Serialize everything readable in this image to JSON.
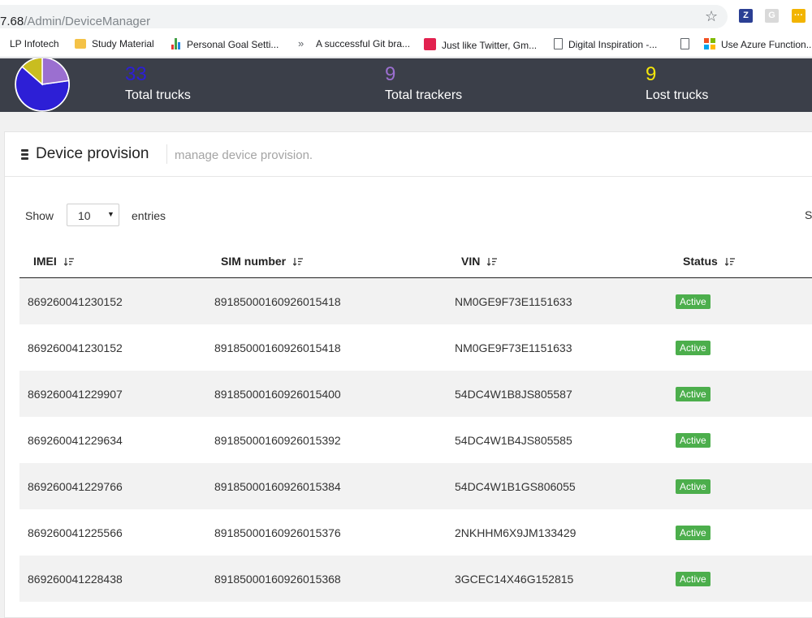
{
  "browser": {
    "url_host": "7.68",
    "url_path": "/Admin/DeviceManager",
    "bookmarks": [
      "LP Infotech",
      "Study Material",
      "Personal Goal Setti...",
      "A successful Git bra...",
      "Just like Twitter, Gm...",
      "Digital Inspiration -...",
      "Use Azure Function..."
    ],
    "extensions": [
      "Z",
      "G",
      ""
    ]
  },
  "stats": {
    "pie_colors": [
      "#2d1fd6",
      "#9b6fd0",
      "#c9bd20"
    ],
    "items": [
      {
        "value": "33",
        "label": "Total trucks",
        "color": "#2d1fd6"
      },
      {
        "value": "9",
        "label": "Total trackers",
        "color": "#9b6fd0"
      },
      {
        "value": "9",
        "label": "Lost trucks",
        "color": "#f5e60b"
      }
    ]
  },
  "panel": {
    "title": "Device provision",
    "subtitle": "manage device provision."
  },
  "controls": {
    "show_label": "Show",
    "page_size": "10",
    "entries_label": "entries",
    "search_label_cut": "S"
  },
  "table": {
    "headers": [
      "IMEI",
      "SIM number",
      "VIN",
      "Status"
    ],
    "rows": [
      {
        "imei": "869260041230152",
        "sim": "89185000160926015418",
        "vin": "NM0GE9F73E1151633",
        "status": "Active"
      },
      {
        "imei": "869260041230152",
        "sim": "89185000160926015418",
        "vin": "NM0GE9F73E1151633",
        "status": "Active"
      },
      {
        "imei": "869260041229907",
        "sim": "89185000160926015400",
        "vin": "54DC4W1B8JS805587",
        "status": "Active"
      },
      {
        "imei": "869260041229634",
        "sim": "89185000160926015392",
        "vin": "54DC4W1B4JS805585",
        "status": "Active"
      },
      {
        "imei": "869260041229766",
        "sim": "89185000160926015384",
        "vin": "54DC4W1B1GS806055",
        "status": "Active"
      },
      {
        "imei": "869260041225566",
        "sim": "89185000160926015376",
        "vin": "2NKHHM6X9JM133429",
        "status": "Active"
      },
      {
        "imei": "869260041228438",
        "sim": "89185000160926015368",
        "vin": "3GCEC14X46G152815",
        "status": "Active"
      }
    ]
  }
}
